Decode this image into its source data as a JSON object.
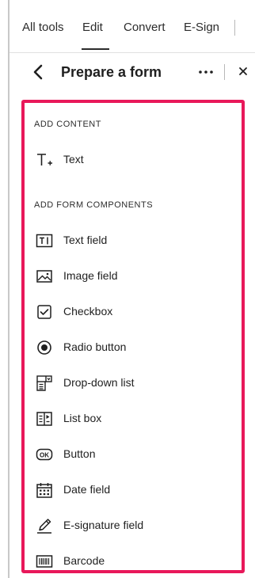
{
  "tabs": [
    {
      "label": "All tools"
    },
    {
      "label": "Edit",
      "selected": true
    },
    {
      "label": "Convert"
    },
    {
      "label": "E-Sign"
    }
  ],
  "panel": {
    "title": "Prepare a form"
  },
  "sections": {
    "add_content": {
      "label": "ADD CONTENT",
      "items": [
        {
          "label": "Text",
          "icon": "text-add-icon"
        }
      ]
    },
    "add_form_components": {
      "label": "ADD FORM COMPONENTS",
      "items": [
        {
          "label": "Text field",
          "icon": "text-field-icon"
        },
        {
          "label": "Image field",
          "icon": "image-field-icon"
        },
        {
          "label": "Checkbox",
          "icon": "checkbox-icon"
        },
        {
          "label": "Radio button",
          "icon": "radio-button-icon"
        },
        {
          "label": "Drop-down list",
          "icon": "dropdown-list-icon"
        },
        {
          "label": "List box",
          "icon": "list-box-icon"
        },
        {
          "label": "Button",
          "icon": "ok-button-icon"
        },
        {
          "label": "Date field",
          "icon": "calendar-icon"
        },
        {
          "label": "E-signature field",
          "icon": "signature-pen-icon"
        },
        {
          "label": "Barcode",
          "icon": "barcode-icon"
        }
      ]
    }
  },
  "colors": {
    "highlight_border": "#e8185a",
    "text": "#1f1f1f"
  }
}
